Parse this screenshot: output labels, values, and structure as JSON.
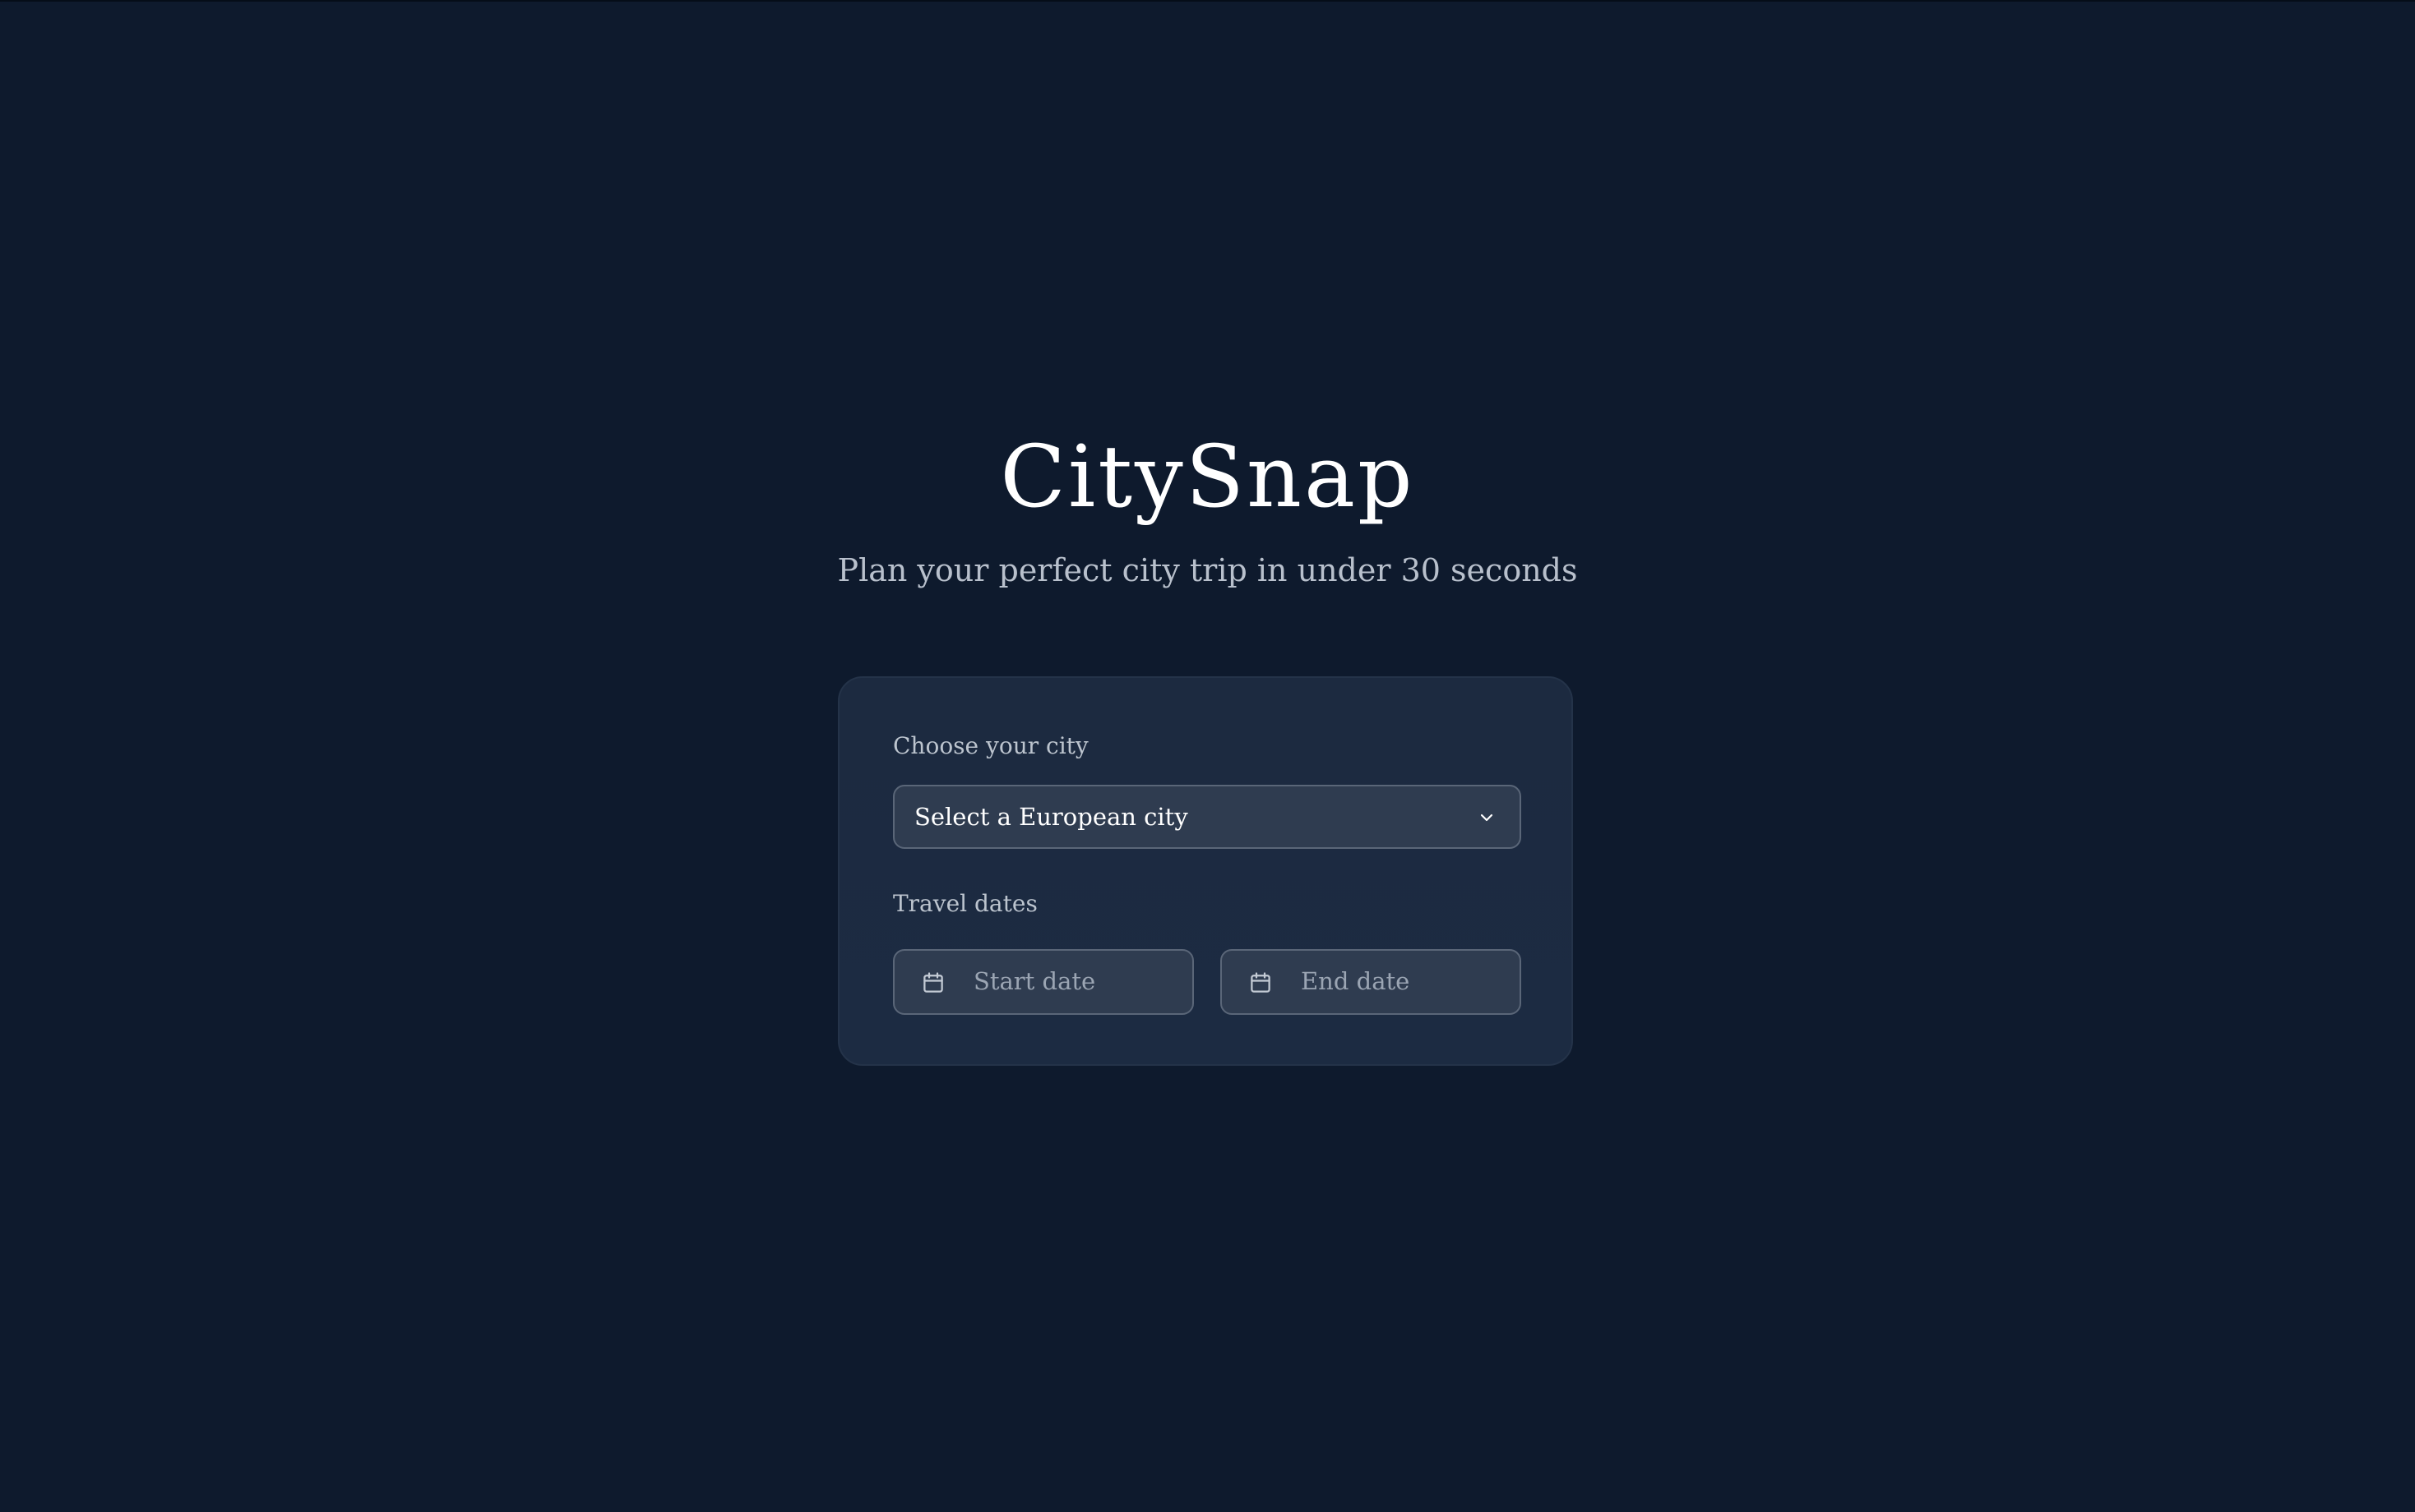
{
  "header": {
    "title": "CitySnap",
    "subtitle": "Plan your perfect city trip in under 30 seconds"
  },
  "form": {
    "city": {
      "label": "Choose your city",
      "selected": "Select a European city",
      "icon": "chevron-down-icon"
    },
    "dates": {
      "label": "Travel dates",
      "start_placeholder": "Start date",
      "end_placeholder": "End date",
      "icon": "calendar-icon"
    }
  },
  "colors": {
    "background": "#0e1a2d",
    "card": "#1c2a40",
    "input": "#2f3c50",
    "input_border": "#5a6678",
    "title": "#ffffff",
    "subtitle": "#b8c0cc"
  }
}
